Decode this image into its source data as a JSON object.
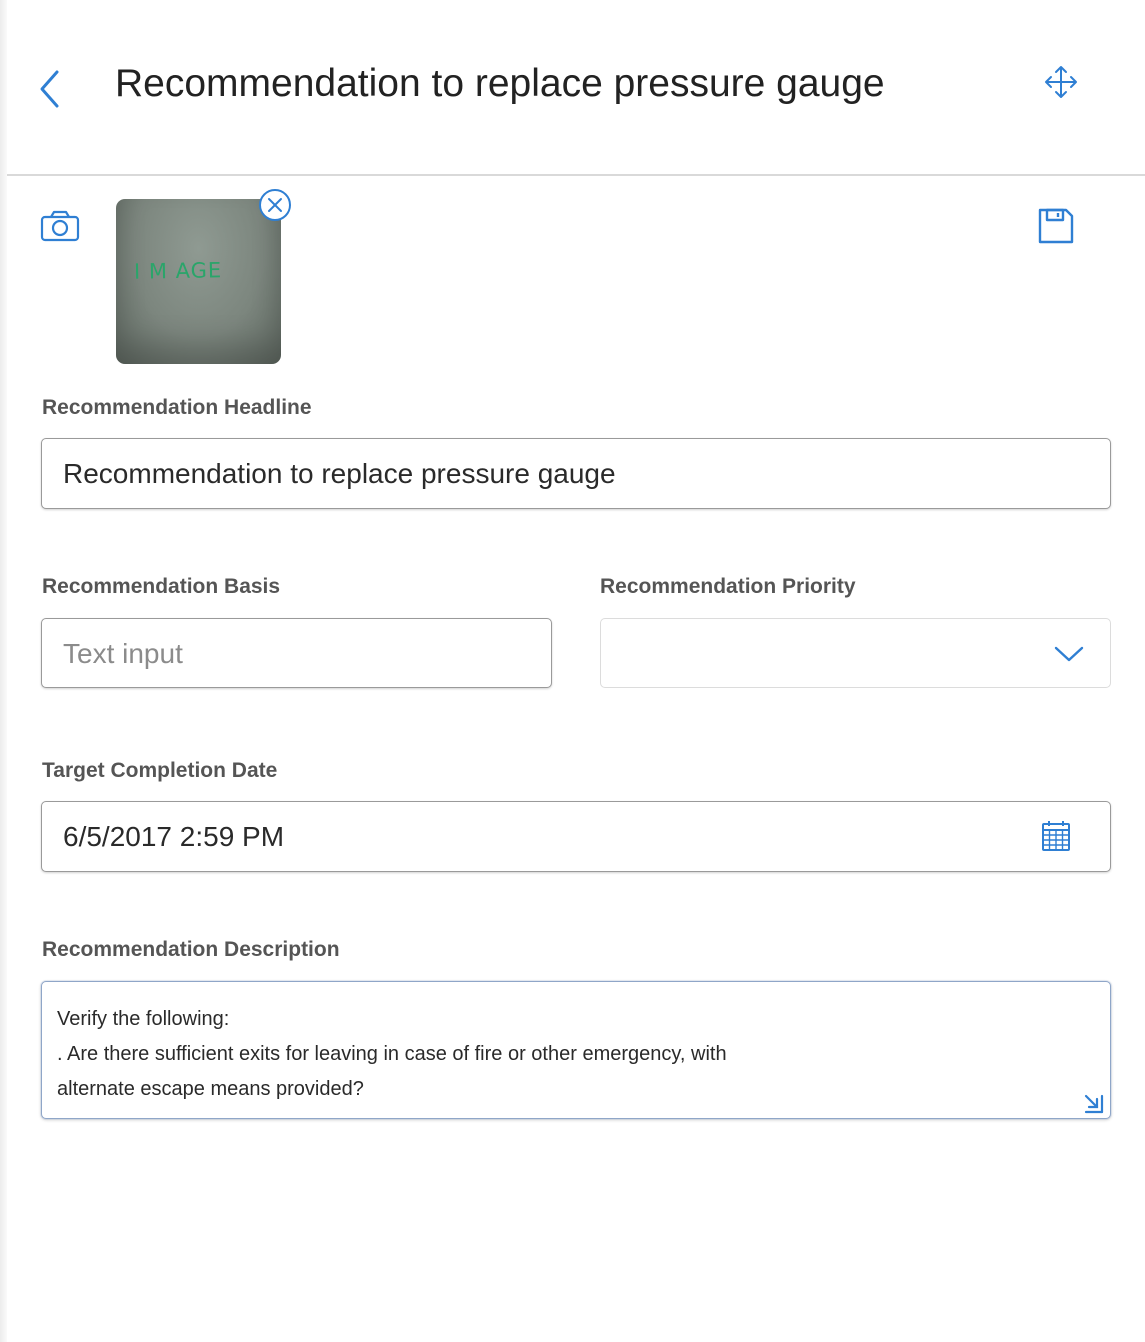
{
  "header": {
    "title": "Recommendation to replace pressure gauge",
    "back_icon": "chevron-left-icon",
    "move_icon": "move-arrows-icon"
  },
  "toolbar": {
    "camera_icon": "camera-icon",
    "save_icon": "floppy-disk-icon"
  },
  "attachment": {
    "thumbnail_text": "I M AGE",
    "remove_icon": "close-circle-icon"
  },
  "form": {
    "headline": {
      "label": "Recommendation Headline",
      "value": "Recommendation to replace pressure gauge"
    },
    "basis": {
      "label": "Recommendation Basis",
      "value": "",
      "placeholder": "Text input"
    },
    "priority": {
      "label": "Recommendation Priority",
      "value": ""
    },
    "target_date": {
      "label": "Target Completion Date",
      "value": "6/5/2017 2:59 PM"
    },
    "description": {
      "label": "Recommendation Description",
      "lines": [
        "Verify the following:",
        ". Are there sufficient exits for leaving in case of fire or other emergency, with",
        "alternate escape means provided?"
      ]
    }
  },
  "colors": {
    "accent": "#2f7fd3",
    "thumbnail_text": "#2aa56a"
  }
}
